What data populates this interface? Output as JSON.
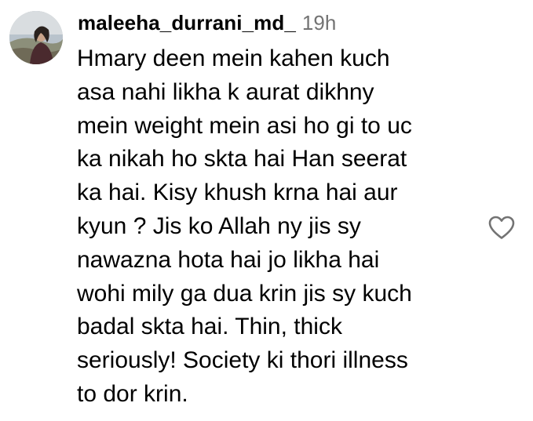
{
  "comment": {
    "username": "maleeha_durrani_md_",
    "timestamp": "19h",
    "lines": [
      "Hmary deen mein kahen kuch",
      "asa nahi likha k aurat dikhny",
      "mein weight mein asi ho gi to uc",
      "ka nikah ho skta hai Han seerat",
      "ka hai. Kisy khush krna hai aur",
      "kyun ? Jis ko Allah ny jis sy",
      "nawazna hota hai jo likha hai",
      "wohi mily ga dua krin jis sy kuch",
      "badal skta hai. Thin, thick",
      "seriously! Society ki thori illness",
      "to dor krin."
    ],
    "like_icon": "heart-outline-icon"
  },
  "colors": {
    "text": "#000000",
    "timestamp": "#737373",
    "icon": "#737373",
    "background": "#ffffff"
  }
}
